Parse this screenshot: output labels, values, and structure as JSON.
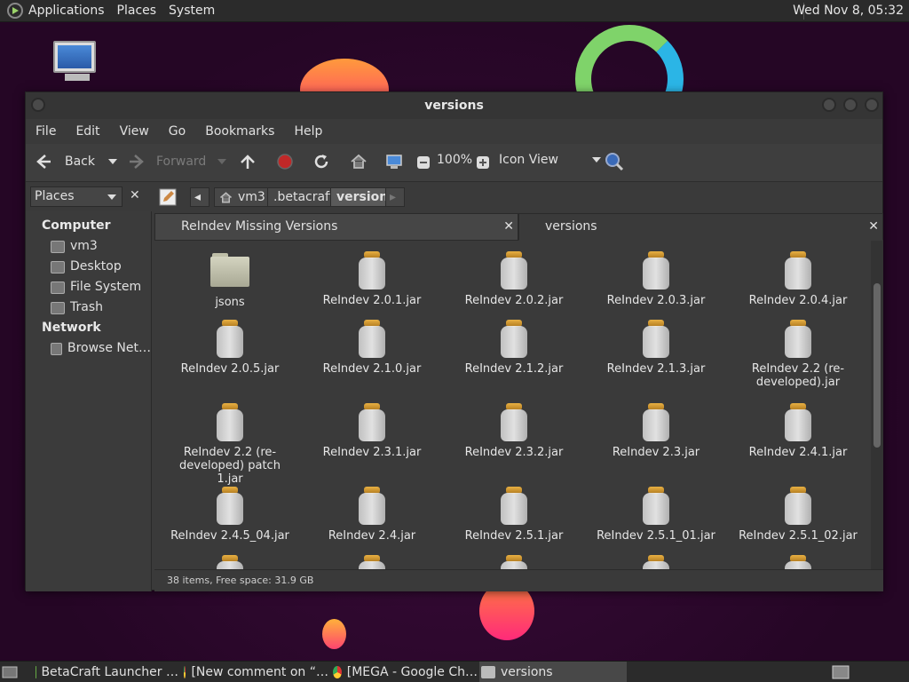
{
  "top_panel": {
    "menus": [
      "Applications",
      "Places",
      "System"
    ],
    "clock": "Wed Nov 8, 05:32"
  },
  "window": {
    "title": "versions",
    "menubar": [
      "File",
      "Edit",
      "View",
      "Go",
      "Bookmarks",
      "Help"
    ],
    "toolbar": {
      "back": "Back",
      "forward": "Forward",
      "zoom": "100%",
      "view_mode": "Icon View"
    },
    "sidebar_select": "Places",
    "breadcrumbs": [
      "vm3",
      ".betacraft",
      "versions"
    ],
    "sidebar": {
      "computer_heading": "Computer",
      "computer_items": [
        "vm3",
        "Desktop",
        "File System",
        "Trash"
      ],
      "network_heading": "Network",
      "network_items": [
        "Browse Net…"
      ]
    },
    "tabs": [
      "ReIndev Missing Versions",
      "versions"
    ],
    "files": [
      [
        "jsons",
        "ReIndev 2.0.1.jar",
        "ReIndev 2.0.2.jar",
        "ReIndev 2.0.3.jar",
        "ReIndev 2.0.4.jar"
      ],
      [
        "ReIndev 2.0.5.jar",
        "ReIndev 2.1.0.jar",
        "ReIndev 2.1.2.jar",
        "ReIndev 2.1.3.jar",
        "ReIndev 2.2 (re-developed).jar"
      ],
      [
        "ReIndev 2.2 (re-developed) patch 1.jar",
        "ReIndev 2.3.1.jar",
        "ReIndev 2.3.2.jar",
        "ReIndev 2.3.jar",
        "ReIndev 2.4.1.jar"
      ],
      [
        "ReIndev 2.4.5_04.jar",
        "ReIndev 2.4.jar",
        "ReIndev 2.5.1.jar",
        "ReIndev 2.5.1_01.jar",
        "ReIndev 2.5.1_02.jar"
      ]
    ],
    "status": "38 items, Free space: 31.9 GB"
  },
  "taskbar": {
    "tasks": [
      "BetaCraft Launcher …",
      "[New comment on “…",
      "[MEGA - Google Ch…",
      "versions"
    ]
  }
}
